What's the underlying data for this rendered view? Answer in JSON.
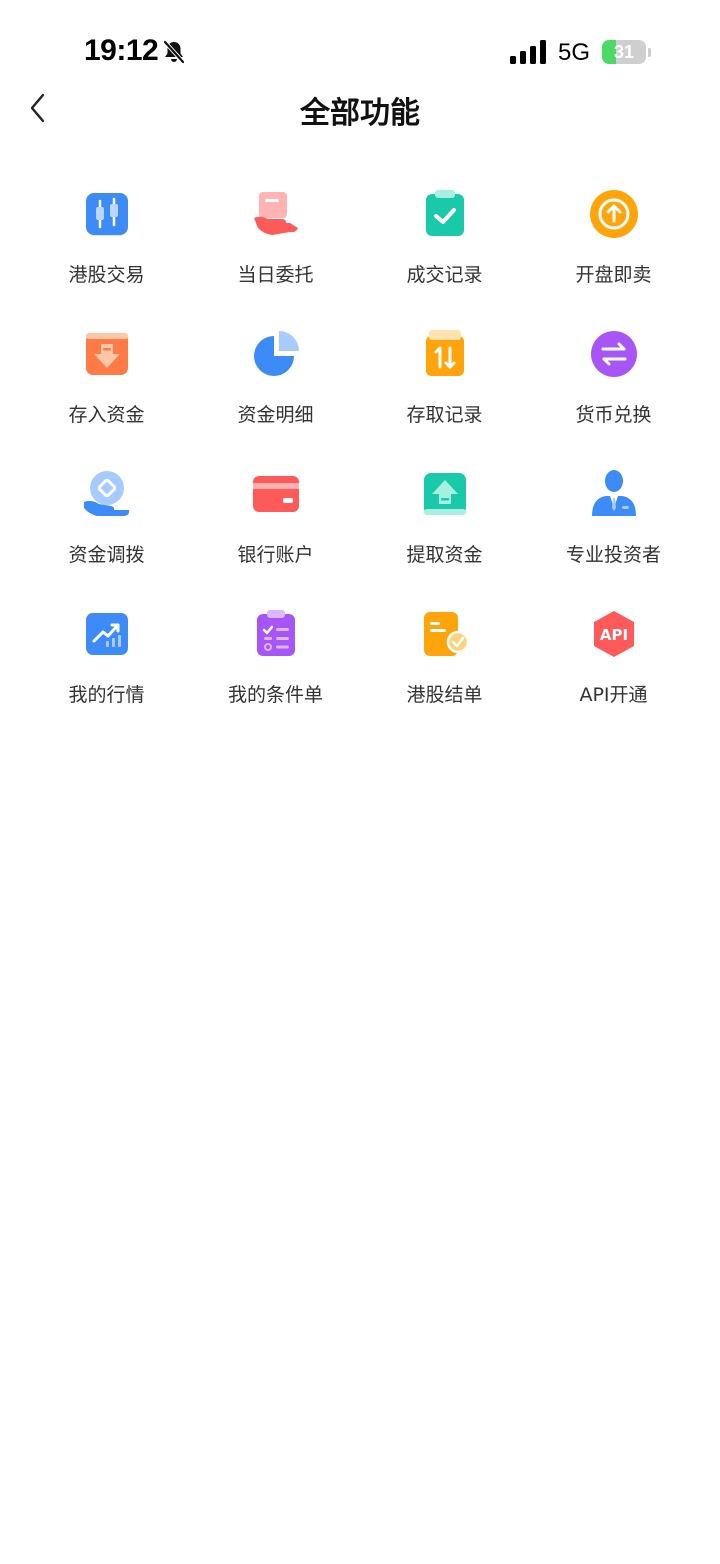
{
  "status_bar": {
    "time": "19:12",
    "network": "5G",
    "battery_level": "31",
    "battery_fraction": 0.31,
    "icons": [
      "bell-slash-icon",
      "signal-icon",
      "battery-charging-icon"
    ]
  },
  "nav": {
    "title": "全部功能",
    "back_icon": "chevron-left-icon"
  },
  "functions": [
    {
      "label": "港股交易",
      "icon": "candlestick-icon",
      "color": "#3d8bf7"
    },
    {
      "label": "当日委托",
      "icon": "hand-card-icon",
      "color": "#ff6b6b"
    },
    {
      "label": "成交记录",
      "icon": "clipboard-check-icon",
      "color": "#19c9a9"
    },
    {
      "label": "开盘即卖",
      "icon": "arrow-up-circle-icon",
      "color": "#ffa40a"
    },
    {
      "label": "存入资金",
      "icon": "deposit-arrow-icon",
      "color": "#ff7a45"
    },
    {
      "label": "资金明细",
      "icon": "pie-chart-icon",
      "color": "#3d8bf7"
    },
    {
      "label": "存取记录",
      "icon": "transfer-record-icon",
      "color": "#ffa40a"
    },
    {
      "label": "货币兑换",
      "icon": "exchange-icon",
      "color": "#a855f7"
    },
    {
      "label": "资金调拨",
      "icon": "coin-hand-icon",
      "color": "#3d8bf7"
    },
    {
      "label": "银行账户",
      "icon": "bank-card-icon",
      "color": "#ff5a5a"
    },
    {
      "label": "提取资金",
      "icon": "withdraw-arrow-icon",
      "color": "#19c9a9"
    },
    {
      "label": "专业投资者",
      "icon": "investor-icon",
      "color": "#3d8bf7"
    },
    {
      "label": "我的行情",
      "icon": "trend-chart-icon",
      "color": "#3d8bf7"
    },
    {
      "label": "我的条件单",
      "icon": "checklist-icon",
      "color": "#a855f7"
    },
    {
      "label": "港股结单",
      "icon": "statement-icon",
      "color": "#ffa40a"
    },
    {
      "label": "API开通",
      "icon": "api-icon",
      "color": "#ff5a5a"
    }
  ]
}
